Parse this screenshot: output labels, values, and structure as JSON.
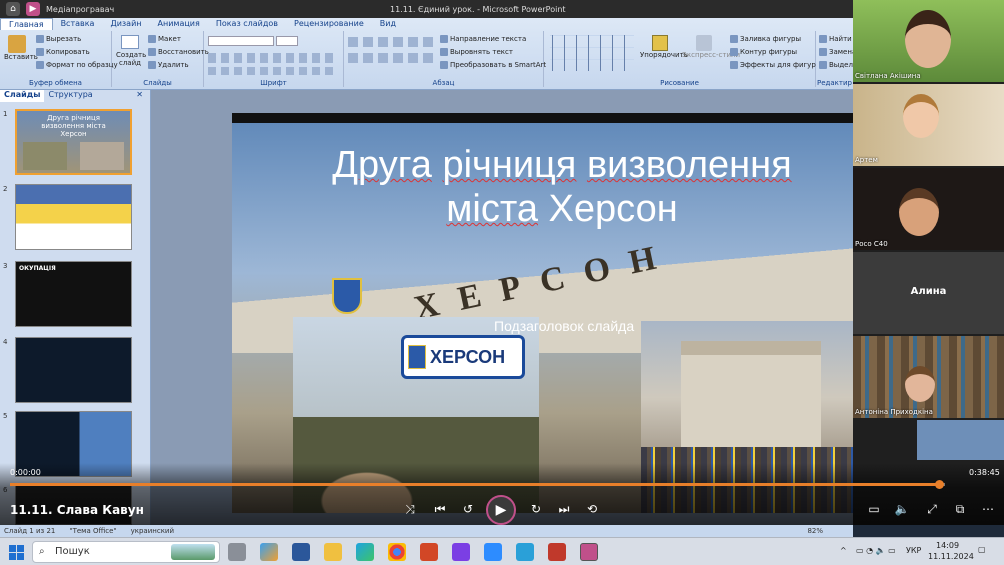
{
  "window": {
    "app_name": "Медіапрогравач",
    "title": "11.11. Єдиний урок. - Microsoft PowerPoint"
  },
  "ribbon": {
    "tabs": [
      "Главная",
      "Вставка",
      "Дизайн",
      "Анимация",
      "Показ слайдов",
      "Рецензирование",
      "Вид"
    ],
    "clipboard": {
      "paste": "Вставить",
      "cut": "Вырезать",
      "copy": "Копировать",
      "format": "Формат по образцу",
      "label": "Буфер обмена"
    },
    "slides": {
      "new_slide": "Создать слайд",
      "layout": "Макет",
      "reset": "Восстановить",
      "delete": "Удалить",
      "label": "Слайды"
    },
    "font": {
      "label": "Шрифт"
    },
    "paragraph": {
      "text_direction": "Направление текста",
      "align_text": "Выровнять текст",
      "smartart": "Преобразовать в SmartArt",
      "label": "Абзац"
    },
    "drawing": {
      "arrange": "Упорядочить",
      "quick_styles": "Экспресс-стили",
      "fill": "Заливка фигуры",
      "outline": "Контур фигуры",
      "effects": "Эффекты для фигур",
      "label": "Рисование"
    },
    "editing": {
      "find": "Найти",
      "replace": "Замена",
      "select": "Выдели",
      "label": "Редактир"
    }
  },
  "left_pane": {
    "tabs": [
      "Слайды",
      "Структура"
    ],
    "thumbnails": [
      {
        "number": "1",
        "caption": "Друга річниця визволення міста Херсон"
      },
      {
        "number": "2",
        "caption": ""
      },
      {
        "number": "3",
        "caption": "ОКУПАЦІЯ"
      },
      {
        "number": "4",
        "caption": ""
      },
      {
        "number": "5",
        "caption": ""
      },
      {
        "number": "6",
        "caption": ""
      }
    ]
  },
  "slide": {
    "title_line1_words": [
      "Друга",
      "річниця",
      "визволення"
    ],
    "title_line2_words": [
      "міста",
      "Херсон"
    ],
    "subtitle": "Подзаголовок слайда",
    "sign_text": "ХЕРСОН",
    "arch_text": "ХЕРСОН"
  },
  "participants": [
    {
      "name": "Світлана Акішина",
      "bg": "#6f9b4a"
    },
    {
      "name": "Артем",
      "bg": "#b7a27a"
    },
    {
      "name": "Росо С40",
      "bg": "#2a2320"
    },
    {
      "name": "Алина",
      "bg": "#3b3b3b"
    },
    {
      "name": "Антоніна Приходкіна",
      "bg": "#7c6548"
    }
  ],
  "player": {
    "current_time": "0:00:00",
    "total_time": "0:38:45",
    "progress": 0.994,
    "title": "11.11. Слава Кавун",
    "accent": "#e87f2a"
  },
  "status_bar": {
    "slide_counter": "Слайд 1 из 21",
    "theme": "\"Тема Office\"",
    "language": "украинский",
    "zoom": "82%"
  },
  "taskbar": {
    "search_placeholder": "Пошук",
    "language": "УКР",
    "time": "14:09",
    "date": "11.11.2024"
  }
}
